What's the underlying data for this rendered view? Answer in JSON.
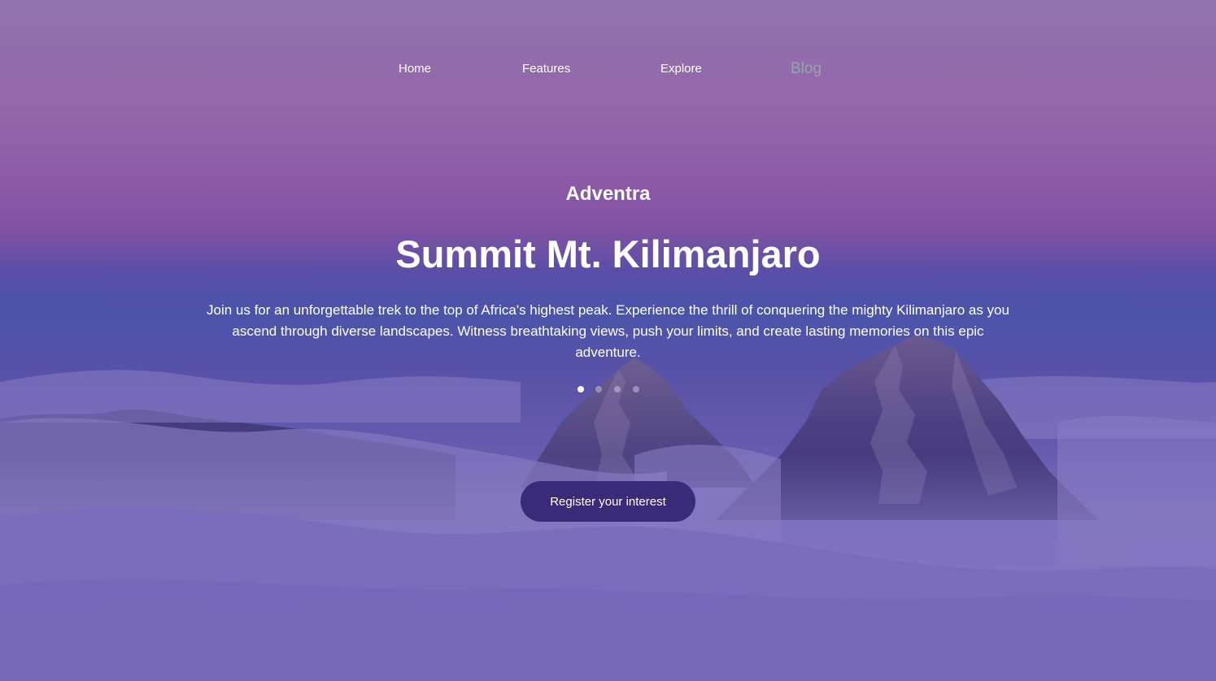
{
  "nav": {
    "items": [
      {
        "label": "Home"
      },
      {
        "label": "Features"
      },
      {
        "label": "Explore"
      },
      {
        "label": "Blog"
      }
    ]
  },
  "hero": {
    "brand": "Adventra",
    "title": "Summit Mt. Kilimanjaro",
    "description": "Join us for an unforgettable trek to the top of Africa's highest peak. Experience the thrill of conquering the mighty Kilimanjaro as you ascend through diverse landscapes. Witness breathtaking views, push your limits, and create lasting memories on this epic adventure.",
    "slide_count": 4,
    "active_slide": 1,
    "cta_label": "Register your interest"
  },
  "colors": {
    "sky_top": "#9172ad",
    "sky_mid": "#4b54aa",
    "cloud": "#7b6cbc",
    "cta_background": "#3a2b78",
    "text": "#ffffff",
    "nav_inactive": "#9aa3a8"
  }
}
